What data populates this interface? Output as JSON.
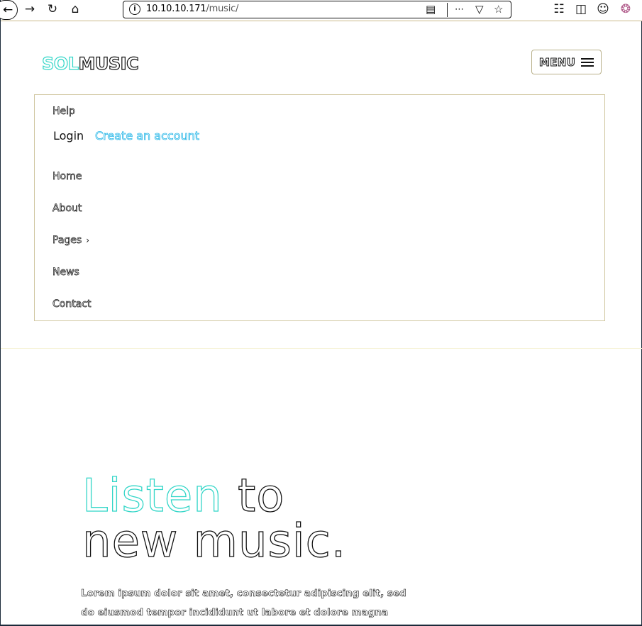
{
  "browser": {
    "url_host": "10.10.10.171",
    "url_path": "/music/"
  },
  "site": {
    "logo_accent": "SOL",
    "logo_main": "MUSIC",
    "menu_label": "MENU"
  },
  "dropdown": {
    "help": "Help",
    "login": "Login",
    "create_account": "Create an account",
    "nav": [
      {
        "label": "Home"
      },
      {
        "label": "About"
      },
      {
        "label": "Pages"
      },
      {
        "label": "News"
      },
      {
        "label": "Contact"
      }
    ]
  },
  "hero": {
    "title_accent": "Listen",
    "title_rest_line1": "to",
    "title_line2": "new music.",
    "text": "Lorem ipsum dolor sit amet, consectetur adipiscing elit, sed do eiusmod tempor incididunt ut labore et dolore magna"
  },
  "colors": {
    "accent": "#33d6c8",
    "link": "#2bb8e8",
    "text": "#111111"
  }
}
